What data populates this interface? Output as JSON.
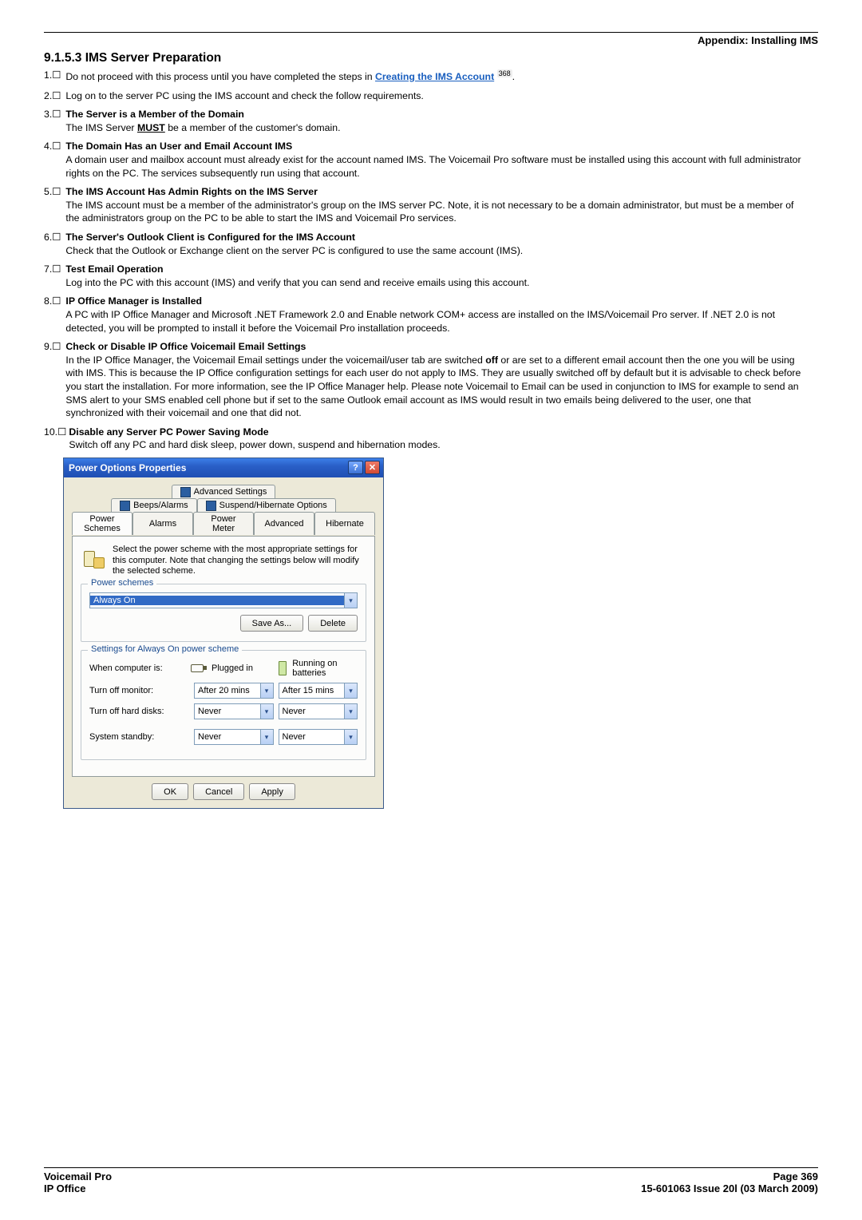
{
  "header": {
    "appendix": "Appendix: Installing IMS"
  },
  "section": {
    "title": "9.1.5.3 IMS Server Preparation"
  },
  "steps": {
    "s1": {
      "num": "1.",
      "pre": "Do not proceed with this process until you have completed the steps in ",
      "link": "Creating the IMS Account",
      "pageref": "368",
      "post": "."
    },
    "s2": {
      "num": "2.",
      "text": "Log on to the server PC using the IMS account and check the follow requirements."
    },
    "s3": {
      "num": "3.",
      "heading": "The Server is a Member of the Domain",
      "l1a": "The IMS Server ",
      "must": "MUST",
      "l1b": " be a member of the customer's domain."
    },
    "s4": {
      "num": "4.",
      "heading": "The Domain Has an User and Email Account IMS",
      "body": "A domain user and mailbox account must already exist for the account named IMS. The Voicemail Pro software must be installed using this account with full administrator rights on the PC. The services subsequently run using that account."
    },
    "s5": {
      "num": "5.",
      "heading": "The IMS Account Has Admin Rights on the IMS Server",
      "body": "The IMS account must be a member of the administrator's group on the IMS server PC. Note, it is not necessary to be a domain administrator, but must be a member of the administrators group on the PC to be able to start the IMS and Voicemail Pro services."
    },
    "s6": {
      "num": "6.",
      "heading": "The Server's Outlook Client is Configured for the IMS Account",
      "body": "Check that the Outlook or Exchange client on the server PC is configured to use the same account (IMS)."
    },
    "s7": {
      "num": "7.",
      "heading": "Test Email Operation",
      "body": "Log into the PC with this account (IMS) and verify that you can send and receive emails using this account."
    },
    "s8": {
      "num": "8.",
      "heading": "IP Office Manager is Installed",
      "body": "A PC with IP Office Manager and Microsoft .NET Framework 2.0 and Enable network COM+ access are installed on the IMS/Voicemail Pro server. If .NET 2.0 is not detected, you will be prompted to install it before the Voicemail Pro installation proceeds."
    },
    "s9": {
      "num": "9.",
      "heading": "Check or Disable IP Office Voicemail Email Settings",
      "body_a": "In the IP Office Manager, the Voicemail Email settings under the voicemail/user tab are switched ",
      "off": "off",
      "body_b": " or are set to a different email account then the one you will be using with IMS. This is because the IP Office configuration settings for each user do not apply to IMS. They are usually switched off by default but it is advisable to check before you start the installation. For more information, see the IP Office Manager help. Please note Voicemail to Email can be used in conjunction to IMS for example to send an SMS alert to your SMS enabled cell phone but if set to the same Outlook email account as IMS would result in two emails being delivered to the user, one that synchronized with their voicemail and one that did not."
    },
    "s10": {
      "num": "10.",
      "heading": "Disable any Server PC Power Saving Mode",
      "body": "Switch off any PC and hard disk sleep, power down, suspend and hibernation modes."
    }
  },
  "dialog": {
    "title": "Power Options Properties",
    "help": "?",
    "close": "✕",
    "tabs": {
      "advanced_settings": "Advanced Settings",
      "beeps_alarms": "Beeps/Alarms",
      "suspend_hibernate": "Suspend/Hibernate Options",
      "power_schemes": "Power Schemes",
      "alarms": "Alarms",
      "power_meter": "Power Meter",
      "advanced": "Advanced",
      "hibernate": "Hibernate"
    },
    "info": "Select the power scheme with the most appropriate settings for this computer. Note that changing the settings below will modify the selected scheme.",
    "group1": {
      "legend": "Power schemes",
      "value": "Always On",
      "save_as": "Save As...",
      "delete": "Delete"
    },
    "group2": {
      "legend": "Settings for Always On power scheme",
      "when": "When computer is:",
      "plugged": "Plugged in",
      "battery": "Running on batteries",
      "row_monitor": {
        "label": "Turn off monitor:",
        "plugged": "After 20 mins",
        "battery": "After 15 mins"
      },
      "row_disks": {
        "label": "Turn off hard disks:",
        "plugged": "Never",
        "battery": "Never"
      },
      "row_standby": {
        "label": "System standby:",
        "plugged": "Never",
        "battery": "Never"
      }
    },
    "buttons": {
      "ok": "OK",
      "cancel": "Cancel",
      "apply": "Apply"
    }
  },
  "footer": {
    "left_top": "Voicemail Pro",
    "left_bot": "IP Office",
    "right_top": "Page 369",
    "right_bot": "15-601063 Issue 20l (03 March 2009)"
  },
  "glyphs": {
    "checkbox": "☐",
    "dropdown": "▾"
  }
}
